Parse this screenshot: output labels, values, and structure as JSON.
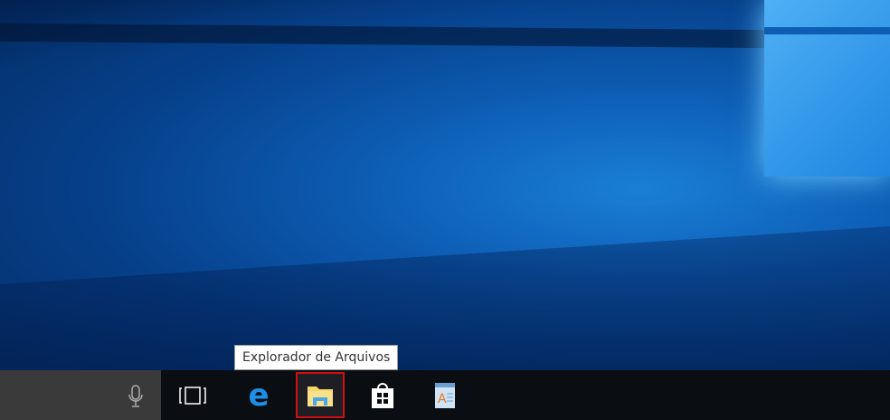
{
  "tooltip": {
    "text": "Explorador de Arquivos"
  },
  "taskbar": {
    "items": [
      {
        "name": "cortana-mic"
      },
      {
        "name": "task-view"
      },
      {
        "name": "edge"
      },
      {
        "name": "file-explorer",
        "highlighted": true
      },
      {
        "name": "store"
      },
      {
        "name": "wordpad"
      }
    ],
    "highlight_color": "#d10f0f"
  }
}
